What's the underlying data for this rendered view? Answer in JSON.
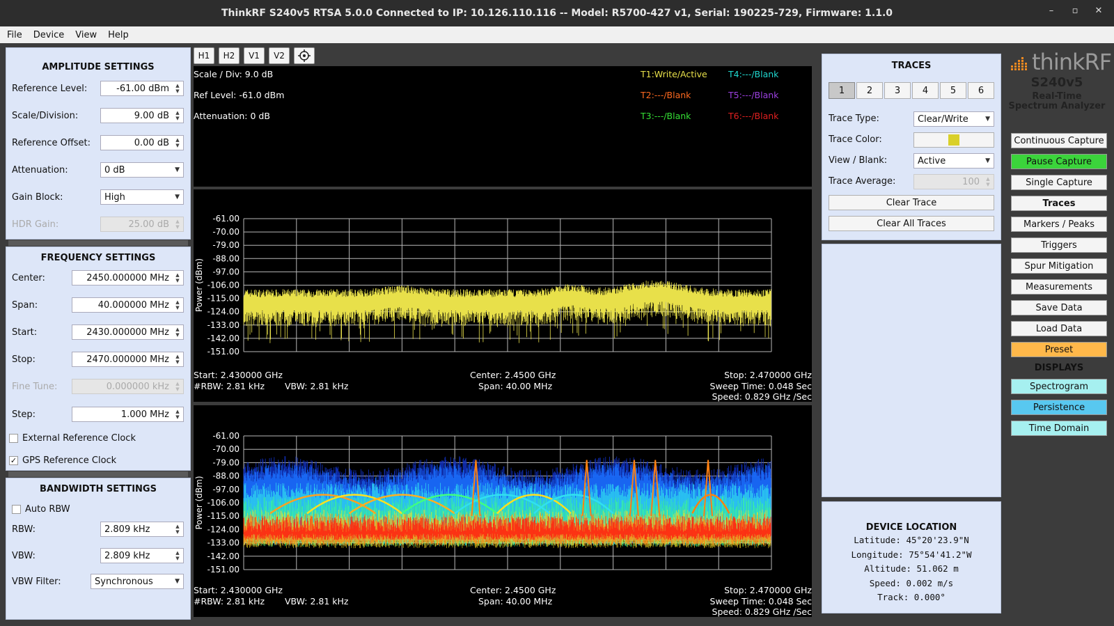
{
  "window": {
    "title": "ThinkRF S240v5 RTSA 5.0.0 Connected to IP: 10.126.110.116 -- Model: R5700-427 v1, Serial: 190225-729, Firmware: 1.1.0",
    "min": "–",
    "max": "▫",
    "close": "✕"
  },
  "menu": [
    "File",
    "Device",
    "View",
    "Help"
  ],
  "amplitude": {
    "title": "AMPLITUDE SETTINGS",
    "ref_level_label": "Reference Level:",
    "ref_level": "-61.00 dBm",
    "scale_label": "Scale/Division:",
    "scale": "9.00 dB",
    "offset_label": "Reference Offset:",
    "offset": "0.00 dB",
    "atten_label": "Attenuation:",
    "atten": "0 dB",
    "gain_label": "Gain Block:",
    "gain": "High",
    "hdr_label": "HDR Gain:",
    "hdr": "25.00 dB"
  },
  "frequency": {
    "title": "FREQUENCY SETTINGS",
    "center_label": "Center:",
    "center": "2450.000000 MHz",
    "span_label": "Span:",
    "span": "40.000000 MHz",
    "start_label": "Start:",
    "start": "2430.000000 MHz",
    "stop_label": "Stop:",
    "stop": "2470.000000 MHz",
    "fine_label": "Fine Tune:",
    "fine": "0.000000 kHz",
    "step_label": "Step:",
    "step": "1.000 MHz",
    "ext_clock": "External Reference Clock",
    "gps_clock": "GPS Reference Clock",
    "gps_check": "✓"
  },
  "bandwidth": {
    "title": "BANDWIDTH SETTINGS",
    "auto_rbw": "Auto RBW",
    "rbw_label": "RBW:",
    "rbw": "2.809 kHz",
    "vbw_label": "VBW:",
    "vbw": "2.809 kHz",
    "vbwf_label": "VBW Filter:",
    "vbwf": "Synchronous"
  },
  "toolbar": [
    "H1",
    "H2",
    "V1",
    "V2"
  ],
  "info": {
    "scale": "Scale / Div: 9.0 dB",
    "ref": "Ref Level: -61.0 dBm",
    "atten": "Attenuation: 0 dB",
    "t1": "T1:Write/Active",
    "t2": "T2:---/Blank",
    "t3": "T3:---/Blank",
    "t4": "T4:---/Blank",
    "t5": "T5:---/Blank",
    "t6": "T6:---/Blank",
    "colors": {
      "t1": "#e8e04a",
      "t2": "#ff6a20",
      "t3": "#35e035",
      "t4": "#20d8d0",
      "t5": "#9b40e0",
      "t6": "#e02020"
    }
  },
  "plot": {
    "ylabel": "Power (dBm)",
    "yticks": [
      "-61.00",
      "-70.00",
      "-79.00",
      "-88.00",
      "-97.00",
      "-106.00",
      "-115.00",
      "-124.00",
      "-133.00",
      "-142.00",
      "-151.00"
    ],
    "start": "Start: 2.430000 GHz",
    "rbw": "#RBW: 2.81 kHz",
    "vbw": "VBW: 2.81 kHz",
    "center": "Center: 2.4500 GHz",
    "span": "Span: 40.00 MHz",
    "stop": "Stop: 2.470000 GHz",
    "sweep": "Sweep Time: 0.048 Sec",
    "speed": "Speed: 0.829 GHz /Sec"
  },
  "traces": {
    "title": "TRACES",
    "numbers": [
      "1",
      "2",
      "3",
      "4",
      "5",
      "6"
    ],
    "type_label": "Trace Type:",
    "type": "Clear/Write",
    "color_label": "Trace Color:",
    "color": "#d9d02a",
    "view_label": "View / Blank:",
    "view": "Active",
    "avg_label": "Trace Average:",
    "avg": "100",
    "clear": "Clear Trace",
    "clear_all": "Clear All Traces"
  },
  "location": {
    "title": "DEVICE LOCATION",
    "lat": "Latitude: 45°20'23.9\"N",
    "lon": "Longitude: 75°54'41.2\"W",
    "alt": "Altitude: 51.062 m",
    "speed": "Speed: 0.002 m/s",
    "track": "Track: 0.000°"
  },
  "brand": {
    "name": "thinkRF",
    "model": "S240v5",
    "line1": "Real-Time",
    "line2": "Spectrum Analyzer"
  },
  "right_buttons": {
    "continuous": "Continuous Capture",
    "pause": "Pause Capture",
    "single": "Single Capture",
    "traces": "Traces",
    "markers": "Markers / Peaks",
    "triggers": "Triggers",
    "spur": "Spur Mitigation",
    "measurements": "Measurements",
    "save": "Save Data",
    "load": "Load Data",
    "preset": "Preset",
    "displays": "DISPLAYS",
    "spectrogram": "Spectrogram",
    "persistence": "Persistence",
    "time_domain": "Time Domain"
  },
  "colors": {
    "pause": "#3bd43b",
    "preset": "#ffb84a",
    "spectrogram": "#a6f0f0",
    "persistence": "#58c8f0",
    "time_domain": "#a6f0f0"
  }
}
